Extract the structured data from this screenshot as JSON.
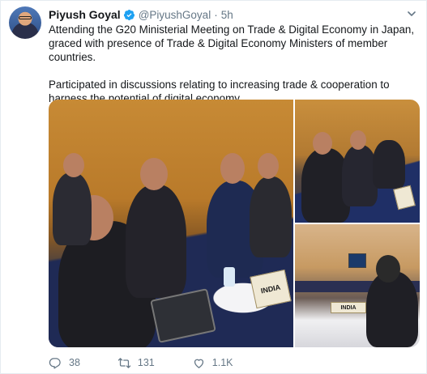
{
  "tweet": {
    "author_name": "Piyush Goyal",
    "handle": "@PiyushGoyal",
    "separator": "·",
    "time": "5h",
    "paragraph1": "Attending the G20 Ministerial Meeting on Trade & Digital Economy in Japan, graced with presence of Trade & Digital Economy Ministers of member countries.",
    "paragraph2": "Participated in discussions relating to increasing trade & cooperation to harness the potential of digital economy."
  },
  "media": {
    "placard_main": "INDIA",
    "placard_bottom_right": "INDIA"
  },
  "actions": {
    "reply_count": "38",
    "retweet_count": "131",
    "like_count": "1.1K"
  },
  "colors": {
    "verified": "#1da1f2",
    "icon_gray": "#657786",
    "text": "#14171a"
  },
  "icons": [
    "verified-badge-icon",
    "caret-down-icon",
    "reply-icon",
    "retweet-icon",
    "like-icon"
  ]
}
